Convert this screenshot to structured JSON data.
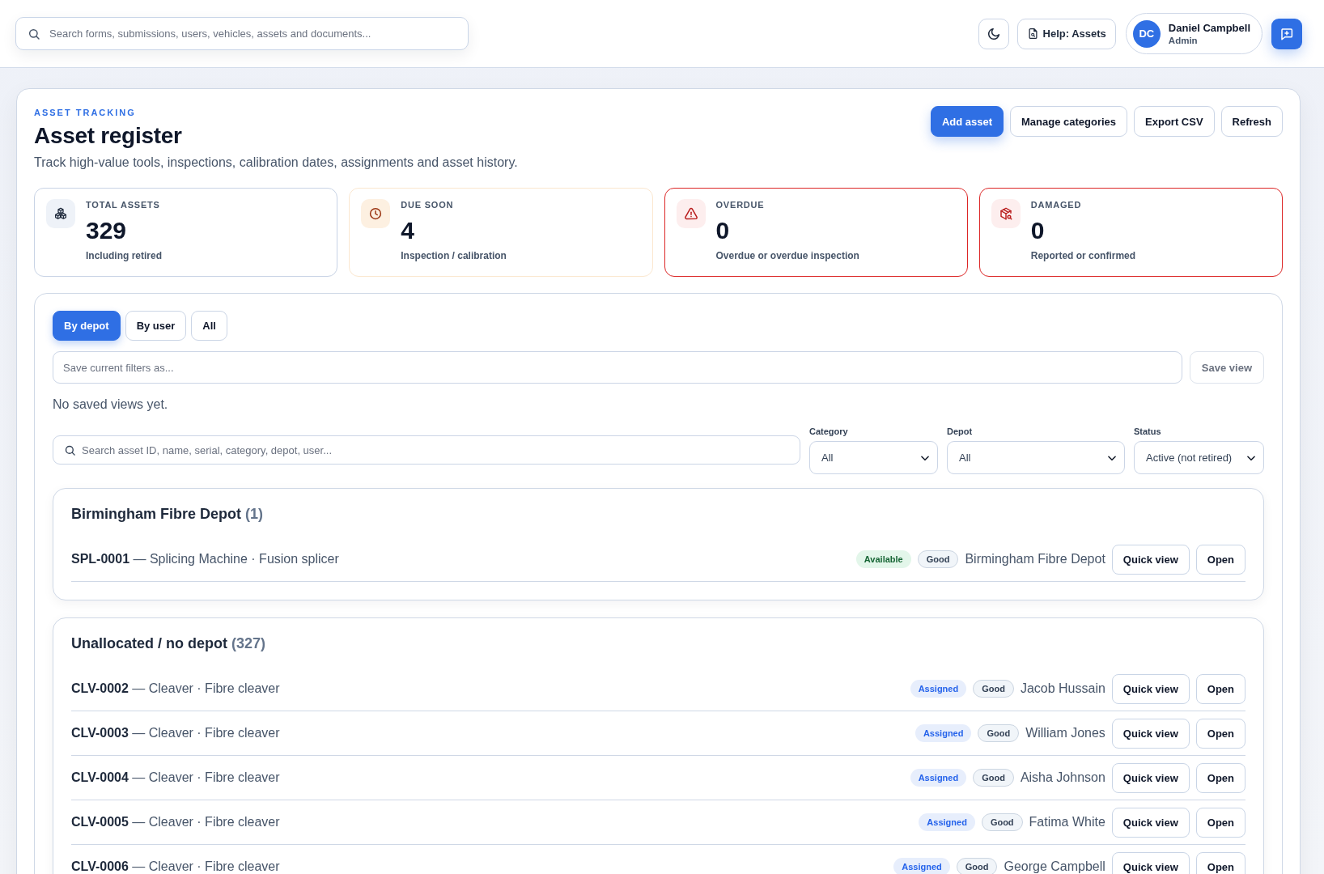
{
  "top_bar": {
    "search": {
      "placeholder": "Search forms, submissions, users, vehicles, assets and documents..."
    },
    "help_button": "Help: Assets",
    "user": {
      "initials": "DC",
      "name": "Daniel Campbell",
      "role": "Admin"
    }
  },
  "header": {
    "eyebrow": "ASSET TRACKING",
    "title": "Asset register",
    "subtitle": "Track high-value tools, inspections, calibration dates, assignments and asset history.",
    "actions": [
      {
        "label": "Add asset",
        "kind": "primary"
      },
      {
        "label": "Manage categories",
        "kind": "secondary"
      },
      {
        "label": "Export CSV",
        "kind": "secondary"
      },
      {
        "label": "Refresh",
        "kind": "secondary"
      }
    ]
  },
  "stats": [
    {
      "kind": "total",
      "label": "TOTAL ASSETS",
      "value": "329",
      "note": "Including retired"
    },
    {
      "kind": "due",
      "label": "DUE SOON",
      "value": "4",
      "note": "Inspection / calibration"
    },
    {
      "kind": "overdue",
      "label": "OVERDUE",
      "value": "0",
      "note": "Overdue or overdue inspection"
    },
    {
      "kind": "damaged",
      "label": "DAMAGED",
      "value": "0",
      "note": "Reported or confirmed"
    }
  ],
  "views": {
    "tabs": [
      {
        "label": "By depot",
        "selected": true
      },
      {
        "label": "By user",
        "selected": false
      },
      {
        "label": "All",
        "selected": false
      }
    ],
    "save_field": {
      "placeholder": "Save current filters as..."
    },
    "save_button": {
      "label": "Save view",
      "disabled": true
    },
    "empty_note": "No saved views yet."
  },
  "filters": {
    "search": {
      "placeholder": "Search asset ID, name, serial, category, depot, user..."
    },
    "selects": [
      {
        "label": "Category",
        "value": "All"
      },
      {
        "label": "Depot",
        "value": "All"
      },
      {
        "label": "Status",
        "value": "Active (not retired)"
      }
    ]
  },
  "groups": [
    {
      "name": "Birmingham Fibre Depot",
      "count": "(1)",
      "rows": [
        {
          "title": "**SPL-0001** — Splicing Machine · Fusion splicer",
          "status": {
            "label": "Available",
            "kind": "available"
          },
          "condition": "Good",
          "holder": "Birmingham Fibre Depot",
          "actions": [
            "Quick view",
            "Open"
          ]
        }
      ]
    },
    {
      "name": "Unallocated / no depot",
      "count": "(327)",
      "rows": [
        {
          "title": "**CLV-0002** — Cleaver · Fibre cleaver",
          "status": {
            "label": "Assigned",
            "kind": "assigned"
          },
          "condition": "Good",
          "holder": "Jacob Hussain",
          "actions": [
            "Quick view",
            "Open"
          ]
        },
        {
          "title": "**CLV-0003** — Cleaver · Fibre cleaver",
          "status": {
            "label": "Assigned",
            "kind": "assigned"
          },
          "condition": "Good",
          "holder": "William Jones",
          "actions": [
            "Quick view",
            "Open"
          ]
        },
        {
          "title": "**CLV-0004** — Cleaver · Fibre cleaver",
          "status": {
            "label": "Assigned",
            "kind": "assigned"
          },
          "condition": "Good",
          "holder": "Aisha Johnson",
          "actions": [
            "Quick view",
            "Open"
          ]
        },
        {
          "title": "**CLV-0005** — Cleaver · Fibre cleaver",
          "status": {
            "label": "Assigned",
            "kind": "assigned"
          },
          "condition": "Good",
          "holder": "Fatima White",
          "actions": [
            "Quick view",
            "Open"
          ]
        },
        {
          "title": "**CLV-0006** — Cleaver · Fibre cleaver",
          "status": {
            "label": "Assigned",
            "kind": "assigned"
          },
          "condition": "Good",
          "holder": "George Campbell",
          "actions": [
            "Quick view",
            "Open"
          ]
        }
      ]
    }
  ]
}
